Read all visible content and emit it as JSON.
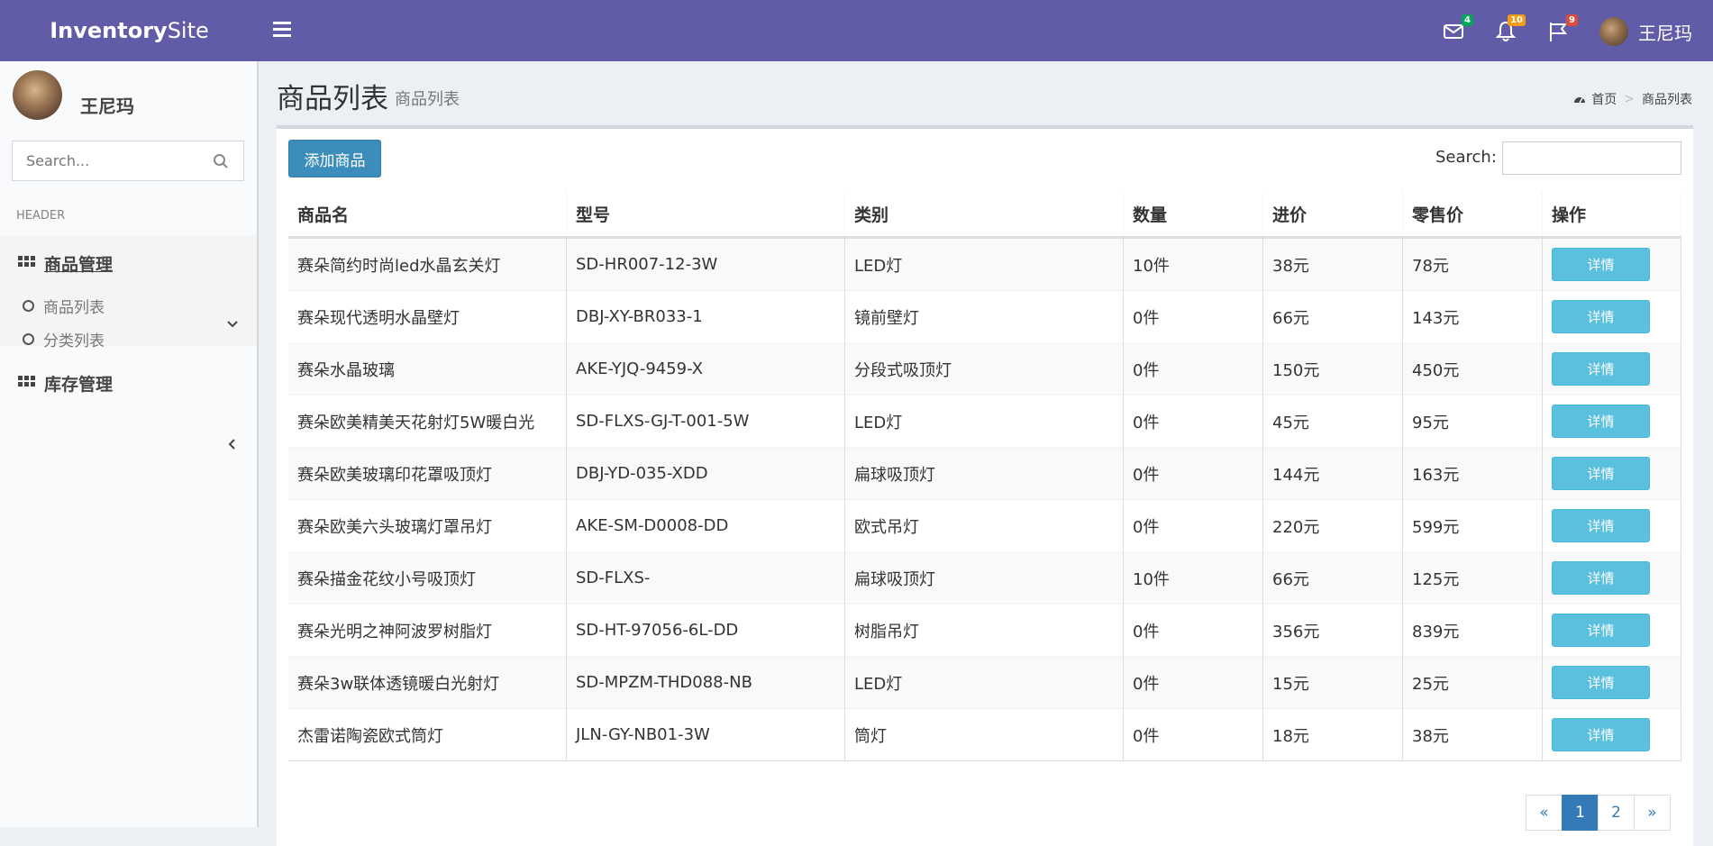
{
  "brand": {
    "bold": "Inventory",
    "light": "Site"
  },
  "topbar": {
    "mail_count": "4",
    "bell_count": "10",
    "flag_count": "9",
    "user_name": "王尼玛"
  },
  "sidebar": {
    "user_name": "王尼玛",
    "search_placeholder": "Search...",
    "header": "HEADER",
    "menus": [
      {
        "label": "商品管理",
        "sub": [
          "商品列表",
          "分类列表"
        ]
      },
      {
        "label": "库存管理"
      }
    ]
  },
  "page": {
    "title": "商品列表",
    "subtitle": "商品列表",
    "breadcrumb": [
      "首页",
      "商品列表"
    ]
  },
  "toolbar": {
    "add_label": "添加商品",
    "search_label": "Search:"
  },
  "table": {
    "columns": [
      "商品名",
      "型号",
      "类别",
      "数量",
      "进价",
      "零售价",
      "操作"
    ],
    "detail_label": "详情",
    "rows": [
      [
        "赛朵简约时尚led水晶玄关灯",
        "SD-HR007-12-3W",
        "LED灯",
        "10件",
        "38元",
        "78元"
      ],
      [
        "赛朵现代透明水晶壁灯",
        "DBJ-XY-BR033-1",
        "镜前壁灯",
        "0件",
        "66元",
        "143元"
      ],
      [
        "赛朵水晶玻璃",
        "AKE-YJQ-9459-X",
        "分段式吸顶灯",
        "0件",
        "150元",
        "450元"
      ],
      [
        "赛朵欧美精美天花射灯5W暖白光",
        "SD-FLXS-GJ-T-001-5W",
        "LED灯",
        "0件",
        "45元",
        "95元"
      ],
      [
        "赛朵欧美玻璃印花罩吸顶灯",
        "DBJ-YD-035-XDD",
        "扁球吸顶灯",
        "0件",
        "144元",
        "163元"
      ],
      [
        "赛朵欧美六头玻璃灯罩吊灯",
        "AKE-SM-D0008-DD",
        "欧式吊灯",
        "0件",
        "220元",
        "599元"
      ],
      [
        "赛朵描金花纹小号吸顶灯",
        "SD-FLXS-",
        "扁球吸顶灯",
        "10件",
        "66元",
        "125元"
      ],
      [
        "赛朵光明之神阿波罗树脂灯",
        "SD-HT-97056-6L-DD",
        "树脂吊灯",
        "0件",
        "356元",
        "839元"
      ],
      [
        "赛朵3w联体透镜暖白光射灯",
        "SD-MPZM-THD088-NB",
        "LED灯",
        "0件",
        "15元",
        "25元"
      ],
      [
        "杰雷诺陶瓷欧式筒灯",
        "JLN-GY-NB01-3W",
        "筒灯",
        "0件",
        "18元",
        "38元"
      ]
    ]
  },
  "pagination": [
    "«",
    "1",
    "2",
    "»"
  ],
  "colors": {
    "header": "#605ca8",
    "primary": "#3c8dbc",
    "info": "#5bc0de"
  }
}
